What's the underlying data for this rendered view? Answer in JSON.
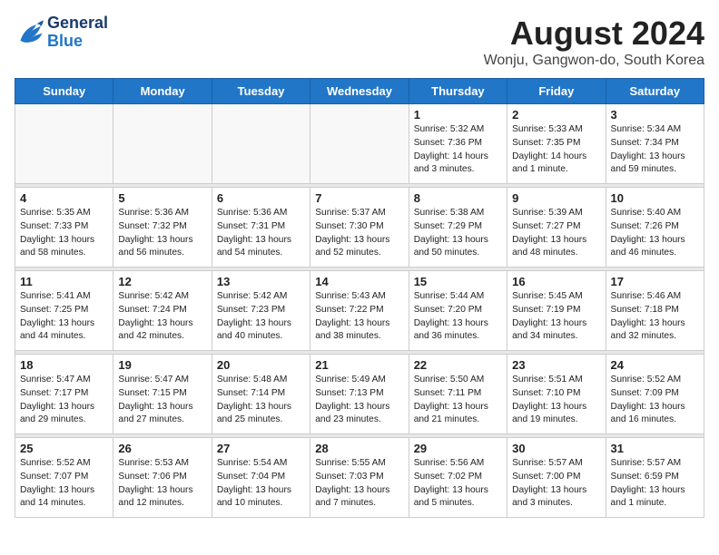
{
  "logo": {
    "line1": "General",
    "line2": "Blue"
  },
  "title": {
    "month_year": "August 2024",
    "location": "Wonju, Gangwon-do, South Korea"
  },
  "weekdays": [
    "Sunday",
    "Monday",
    "Tuesday",
    "Wednesday",
    "Thursday",
    "Friday",
    "Saturday"
  ],
  "weeks": [
    [
      {
        "day": "",
        "info": ""
      },
      {
        "day": "",
        "info": ""
      },
      {
        "day": "",
        "info": ""
      },
      {
        "day": "",
        "info": ""
      },
      {
        "day": "1",
        "info": "Sunrise: 5:32 AM\nSunset: 7:36 PM\nDaylight: 14 hours\nand 3 minutes."
      },
      {
        "day": "2",
        "info": "Sunrise: 5:33 AM\nSunset: 7:35 PM\nDaylight: 14 hours\nand 1 minute."
      },
      {
        "day": "3",
        "info": "Sunrise: 5:34 AM\nSunset: 7:34 PM\nDaylight: 13 hours\nand 59 minutes."
      }
    ],
    [
      {
        "day": "4",
        "info": "Sunrise: 5:35 AM\nSunset: 7:33 PM\nDaylight: 13 hours\nand 58 minutes."
      },
      {
        "day": "5",
        "info": "Sunrise: 5:36 AM\nSunset: 7:32 PM\nDaylight: 13 hours\nand 56 minutes."
      },
      {
        "day": "6",
        "info": "Sunrise: 5:36 AM\nSunset: 7:31 PM\nDaylight: 13 hours\nand 54 minutes."
      },
      {
        "day": "7",
        "info": "Sunrise: 5:37 AM\nSunset: 7:30 PM\nDaylight: 13 hours\nand 52 minutes."
      },
      {
        "day": "8",
        "info": "Sunrise: 5:38 AM\nSunset: 7:29 PM\nDaylight: 13 hours\nand 50 minutes."
      },
      {
        "day": "9",
        "info": "Sunrise: 5:39 AM\nSunset: 7:27 PM\nDaylight: 13 hours\nand 48 minutes."
      },
      {
        "day": "10",
        "info": "Sunrise: 5:40 AM\nSunset: 7:26 PM\nDaylight: 13 hours\nand 46 minutes."
      }
    ],
    [
      {
        "day": "11",
        "info": "Sunrise: 5:41 AM\nSunset: 7:25 PM\nDaylight: 13 hours\nand 44 minutes."
      },
      {
        "day": "12",
        "info": "Sunrise: 5:42 AM\nSunset: 7:24 PM\nDaylight: 13 hours\nand 42 minutes."
      },
      {
        "day": "13",
        "info": "Sunrise: 5:42 AM\nSunset: 7:23 PM\nDaylight: 13 hours\nand 40 minutes."
      },
      {
        "day": "14",
        "info": "Sunrise: 5:43 AM\nSunset: 7:22 PM\nDaylight: 13 hours\nand 38 minutes."
      },
      {
        "day": "15",
        "info": "Sunrise: 5:44 AM\nSunset: 7:20 PM\nDaylight: 13 hours\nand 36 minutes."
      },
      {
        "day": "16",
        "info": "Sunrise: 5:45 AM\nSunset: 7:19 PM\nDaylight: 13 hours\nand 34 minutes."
      },
      {
        "day": "17",
        "info": "Sunrise: 5:46 AM\nSunset: 7:18 PM\nDaylight: 13 hours\nand 32 minutes."
      }
    ],
    [
      {
        "day": "18",
        "info": "Sunrise: 5:47 AM\nSunset: 7:17 PM\nDaylight: 13 hours\nand 29 minutes."
      },
      {
        "day": "19",
        "info": "Sunrise: 5:47 AM\nSunset: 7:15 PM\nDaylight: 13 hours\nand 27 minutes."
      },
      {
        "day": "20",
        "info": "Sunrise: 5:48 AM\nSunset: 7:14 PM\nDaylight: 13 hours\nand 25 minutes."
      },
      {
        "day": "21",
        "info": "Sunrise: 5:49 AM\nSunset: 7:13 PM\nDaylight: 13 hours\nand 23 minutes."
      },
      {
        "day": "22",
        "info": "Sunrise: 5:50 AM\nSunset: 7:11 PM\nDaylight: 13 hours\nand 21 minutes."
      },
      {
        "day": "23",
        "info": "Sunrise: 5:51 AM\nSunset: 7:10 PM\nDaylight: 13 hours\nand 19 minutes."
      },
      {
        "day": "24",
        "info": "Sunrise: 5:52 AM\nSunset: 7:09 PM\nDaylight: 13 hours\nand 16 minutes."
      }
    ],
    [
      {
        "day": "25",
        "info": "Sunrise: 5:52 AM\nSunset: 7:07 PM\nDaylight: 13 hours\nand 14 minutes."
      },
      {
        "day": "26",
        "info": "Sunrise: 5:53 AM\nSunset: 7:06 PM\nDaylight: 13 hours\nand 12 minutes."
      },
      {
        "day": "27",
        "info": "Sunrise: 5:54 AM\nSunset: 7:04 PM\nDaylight: 13 hours\nand 10 minutes."
      },
      {
        "day": "28",
        "info": "Sunrise: 5:55 AM\nSunset: 7:03 PM\nDaylight: 13 hours\nand 7 minutes."
      },
      {
        "day": "29",
        "info": "Sunrise: 5:56 AM\nSunset: 7:02 PM\nDaylight: 13 hours\nand 5 minutes."
      },
      {
        "day": "30",
        "info": "Sunrise: 5:57 AM\nSunset: 7:00 PM\nDaylight: 13 hours\nand 3 minutes."
      },
      {
        "day": "31",
        "info": "Sunrise: 5:57 AM\nSunset: 6:59 PM\nDaylight: 13 hours\nand 1 minute."
      }
    ]
  ]
}
